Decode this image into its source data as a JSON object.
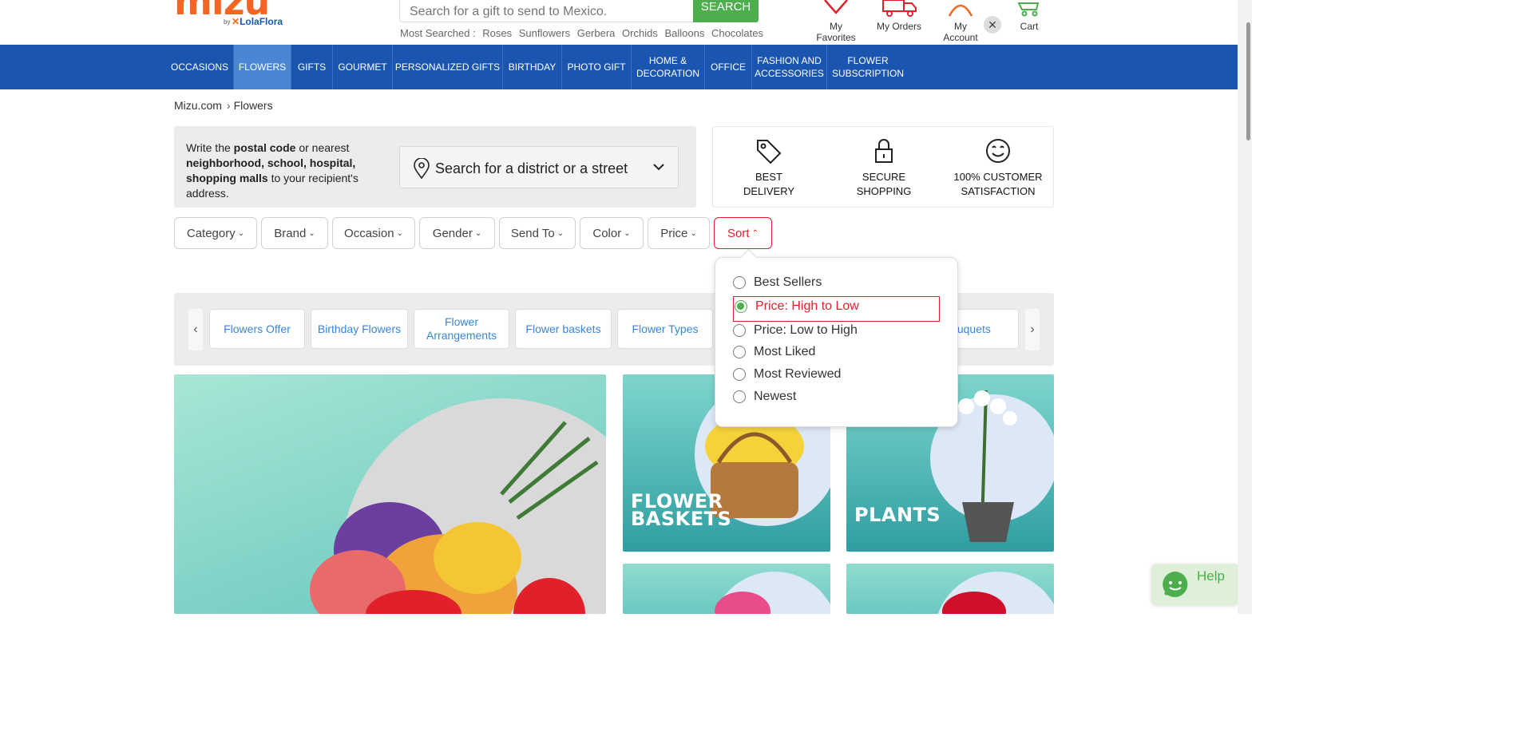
{
  "header": {
    "logo": "mizu",
    "logo_by": "by",
    "logo_brand": "LolaFlora",
    "search_placeholder": "Search for a gift to send to Mexico.",
    "search_button": "SEARCH",
    "most_searched_label": "Most Searched :",
    "most_searched": [
      "Roses",
      "Sunflowers",
      "Gerbera",
      "Orchids",
      "Balloons",
      "Chocolates"
    ],
    "favorites": "My Favorites",
    "orders": "My Orders",
    "account": "My Account",
    "cart": "Cart"
  },
  "nav": {
    "items": [
      "OCCASIONS",
      "FLOWERS",
      "GIFTS",
      "GOURMET",
      "PERSONALIZED GIFTS",
      "BIRTHDAY",
      "PHOTO GIFT",
      "HOME & DECORATION",
      "OFFICE",
      "FASHION AND ACCESSORIES",
      "FLOWER SUBSCRIPTION"
    ],
    "active": "FLOWERS"
  },
  "breadcrumb": [
    "Mizu.com",
    "Flowers"
  ],
  "address": {
    "t1": "Write the ",
    "b1": "postal code",
    "t2": " or nearest ",
    "b2": "neighborhood, school, hospital, shopping malls",
    "t3": " to your recipient's address.",
    "district_placeholder": "Search for a district or a street"
  },
  "trust": [
    {
      "icon": "tag-icon",
      "line1": "BEST",
      "line2": "DELIVERY"
    },
    {
      "icon": "lock-icon",
      "line1": "SECURE",
      "line2": "SHOPPING"
    },
    {
      "icon": "smiley-icon",
      "line1": "100% CUSTOMER",
      "line2": "SATISFACTION"
    }
  ],
  "filters": [
    "Category",
    "Brand",
    "Occasion",
    "Gender",
    "Send To",
    "Color",
    "Price",
    "Sort"
  ],
  "categories": [
    "Flowers Offer",
    "Birthday Flowers",
    "Flower Arrangements",
    "Flower baskets",
    "Flower Types",
    "ouquets"
  ],
  "banners": {
    "baskets": "FLOWER BASKETS",
    "plants": "PLANTS"
  },
  "sort_menu": {
    "options": [
      "Best Sellers",
      "Price: High to Low",
      "Price: Low to High",
      "Most Liked",
      "Most Reviewed",
      "Newest"
    ],
    "selected": "Price: High to Low"
  },
  "help": "Help",
  "colors": {
    "brand_orange": "#f26522",
    "nav_blue": "#1a56b0",
    "accent_green": "#4cae4c",
    "sort_red": "#e0202b"
  }
}
